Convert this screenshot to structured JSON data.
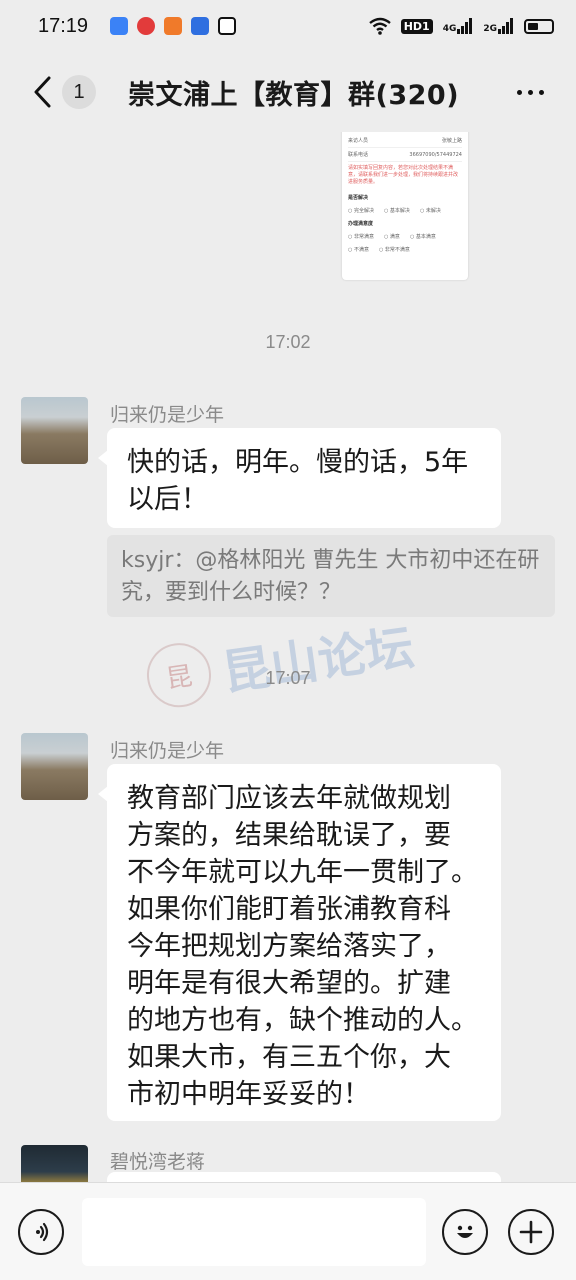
{
  "status_bar": {
    "time": "17:19",
    "notification_icons": [
      "app-blue-icon",
      "app-red-icon",
      "app-orange-icon",
      "app-infinity-icon",
      "app-tiktok-icon"
    ],
    "wifi_icon": "wifi-icon",
    "hd_label": "HD1",
    "signal_1": "4G",
    "signal_2": "2G",
    "battery_icon": "battery-icon"
  },
  "header": {
    "back_icon": "chevron-left-icon",
    "unread_count": "1",
    "title": "崇文浦上【教育】群(320)",
    "more_icon": "more-dots-icon"
  },
  "shared_image": {
    "row1_label": "来访人员",
    "row1_value": "张敏上路",
    "row2_label": "联系电话",
    "row2_value": "36697090/57449724",
    "notice": "请如实填写回复内容，若您对此次处理结果不满意，请联系我们进一步处理，我们将持续跟进并改进服务质量。",
    "q1": "是否解决",
    "q1_options": [
      "完全解决",
      "基本解决",
      "未解决"
    ],
    "q2": "办理满意度",
    "q2_options": [
      "非常满意",
      "满意",
      "基本满意"
    ],
    "q2_options_2": [
      "不满意",
      "非常不满意"
    ]
  },
  "messages": {
    "time_1": "17:02",
    "msg1": {
      "sender": "归来仍是少年",
      "text_line1": "快的话，明年。慢的话，5年",
      "text_line2": "以后！",
      "quote": "ksyjr：@格林阳光  曹先生 大市初中还在研究，要到什么时候？？"
    },
    "time_2": "17:07",
    "msg2": {
      "sender": "归来仍是少年",
      "lines": [
        "教育部门应该去年就做规划",
        "方案的，结果给耽误了，要",
        "不今年就可以九年一贯制了。",
        "如果你们能盯着张浦教育科",
        "今年把规划方案给落实了，",
        "明年是有很大希望的。扩建",
        "的地方也有，缺个推动的人。",
        "如果大市，有三五个你，大",
        "市初中明年妥妥的！"
      ]
    },
    "msg3": {
      "sender": "碧悦湾老蒋"
    }
  },
  "watermark": {
    "seal": "昆",
    "text": "昆山论坛"
  },
  "input_bar": {
    "voice_icon": "voice-icon",
    "emoji_icon": "emoji-icon",
    "plus_icon": "plus-icon"
  }
}
